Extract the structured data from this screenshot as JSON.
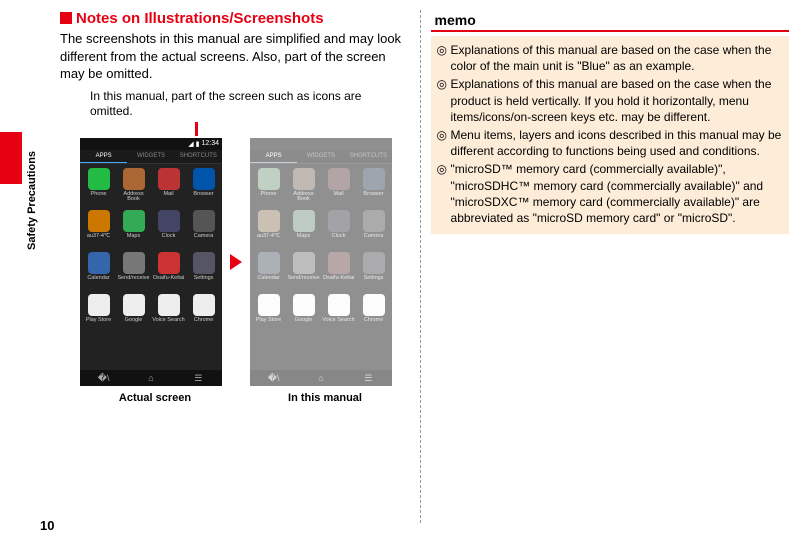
{
  "side_label": "Safety Precautions",
  "page_number": "10",
  "left": {
    "heading": "Notes on Illustrations/Screenshots",
    "intro": "The screenshots in this manual are simplified and may look different from the actual screens. Also, part of the screen may be omitted.",
    "small_note": "In this manual, part of the screen such as icons are omitted.",
    "caption_actual": "Actual screen",
    "caption_manual": "In this manual",
    "phone": {
      "time": "12:34",
      "tabs": {
        "apps": "APPS",
        "widgets": "WIDGETS",
        "shortcuts": "SHORTCUTS"
      },
      "apps": [
        {
          "label": "Phone",
          "bg": "#2b4"
        },
        {
          "label": "Address Book",
          "bg": "#a63"
        },
        {
          "label": "Mail",
          "bg": "#b33"
        },
        {
          "label": "Browser",
          "bg": "#05a"
        },
        {
          "label": "au37-4℃",
          "bg": "#c70"
        },
        {
          "label": "Maps",
          "bg": "#3a5"
        },
        {
          "label": "Clock",
          "bg": "#446"
        },
        {
          "label": "Camera",
          "bg": "#555"
        },
        {
          "label": "Calendar",
          "bg": "#36a"
        },
        {
          "label": "Send/receive",
          "bg": "#777"
        },
        {
          "label": "Osaifu-Keitai",
          "bg": "#c33"
        },
        {
          "label": "Settings",
          "bg": "#556"
        },
        {
          "label": "Play Store",
          "bg": "#eee"
        },
        {
          "label": "Google",
          "bg": "#eee"
        },
        {
          "label": "Voice Search",
          "bg": "#eee"
        },
        {
          "label": "Chrome",
          "bg": "#eee"
        }
      ]
    }
  },
  "right": {
    "memo_title": "memo",
    "items": [
      "Explanations of this manual are based on the case when the color of the main unit is \"Blue\" as an example.",
      "Explanations of this manual are based on the case when the product is held vertically. If you hold it horizontally, menu items/icons/on-screen keys etc. may be different.",
      "Menu items, layers and icons described in this manual may be different according to functions being used and conditions.",
      "\"microSD™ memory card (commercially available)\", \"microSDHC™ memory card (commercially available)\" and \"microSDXC™ memory card (commercially available)\" are abbreviated as \"microSD memory card\" or \"microSD\"."
    ]
  }
}
